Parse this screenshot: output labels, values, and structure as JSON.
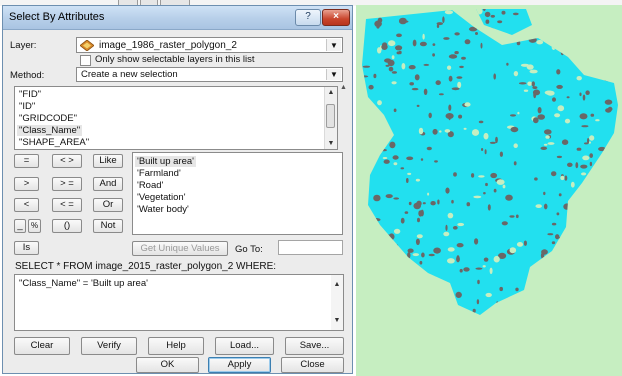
{
  "dialog": {
    "title": "Select By Attributes",
    "help_button": "?",
    "close_button": "×",
    "layer_label": "Layer:",
    "layer_value": "image_1986_raster_polygon_2",
    "only_selectable_label": "Only show selectable layers in this list",
    "method_label": "Method:",
    "method_value": "Create a new selection",
    "fields": [
      "\"FID\"",
      "\"ID\"",
      "\"GRIDCODE\"",
      "\"Class_Name\"",
      "\"SHAPE_AREA\""
    ],
    "selected_field": "\"Class_Name\"",
    "operators": {
      "eq": "=",
      "ne": "< >",
      "like": "Like",
      "gt": ">",
      "ge": "> =",
      "and": "And",
      "lt": "<",
      "le": "< =",
      "or": "Or",
      "underscore": "_",
      "percent": "%",
      "parens": "()",
      "not": "Not",
      "is": "Is"
    },
    "values": [
      "'Built up area'",
      "'Farmland'",
      "'Road'",
      "'Vegetation'",
      "'Water body'"
    ],
    "get_unique_values": "Get Unique Values",
    "go_to_label": "Go To:",
    "go_to_value": "",
    "where_label": "SELECT * FROM image_2015_raster_polygon_2 WHERE:",
    "where_expression": "\"Class_Name\" = 'Built up area'",
    "buttons": {
      "clear": "Clear",
      "verify": "Verify",
      "help": "Help",
      "load": "Load...",
      "save": "Save..."
    },
    "footer": {
      "ok": "OK",
      "apply": "Apply",
      "close": "Close"
    }
  },
  "colors": {
    "water": "#22e0ef",
    "built_up": "#6a6767",
    "background": "#c6eec1"
  }
}
